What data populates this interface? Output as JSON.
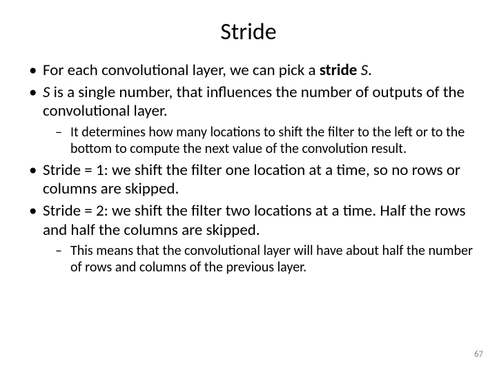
{
  "title": "Stride",
  "bullets": {
    "b1_pre": "For each convolutional layer, we can pick a ",
    "b1_bold": "stride",
    "b1_mid": " ",
    "b1_italic": "S",
    "b1_post": ".",
    "b2_italic": "S",
    "b2_post": " is a single number, that influences the number of outputs of the convolutional layer.",
    "b2_sub1": "It determines how many locations to shift the filter to the left or to the bottom to compute the next value of the convolution result.",
    "b3": "Stride = 1: we shift the filter one location at a time, so no rows or columns are skipped.",
    "b4": "Stride = 2: we shift the filter two locations at a time. Half the rows and half the columns are skipped.",
    "b4_sub1": "This means that the convolutional layer will have about half the number of rows and columns of the previous layer."
  },
  "page_number": "67"
}
